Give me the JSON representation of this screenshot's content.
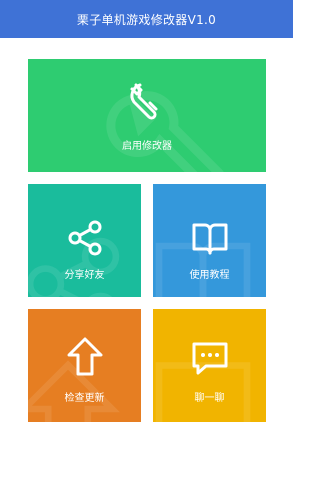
{
  "app": {
    "title": "栗子单机游戏修改器V1.0"
  },
  "colors": {
    "titlebar": "#3f72d6",
    "start_tile": "#2ecc71",
    "share_tile": "#1abc9c",
    "help_tile": "#3498db",
    "update_tile": "#e67e22",
    "chat_tile": "#f1b400"
  },
  "tiles": {
    "start": {
      "label": "启用修改器",
      "icon": "wrench-icon"
    },
    "share": {
      "label": "分享好友",
      "icon": "share-icon"
    },
    "help": {
      "label": "使用教程",
      "icon": "book-icon"
    },
    "update": {
      "label": "检查更新",
      "icon": "arrow-up-icon"
    },
    "chat": {
      "label": "聊一聊",
      "icon": "chat-bubble-icon"
    }
  }
}
